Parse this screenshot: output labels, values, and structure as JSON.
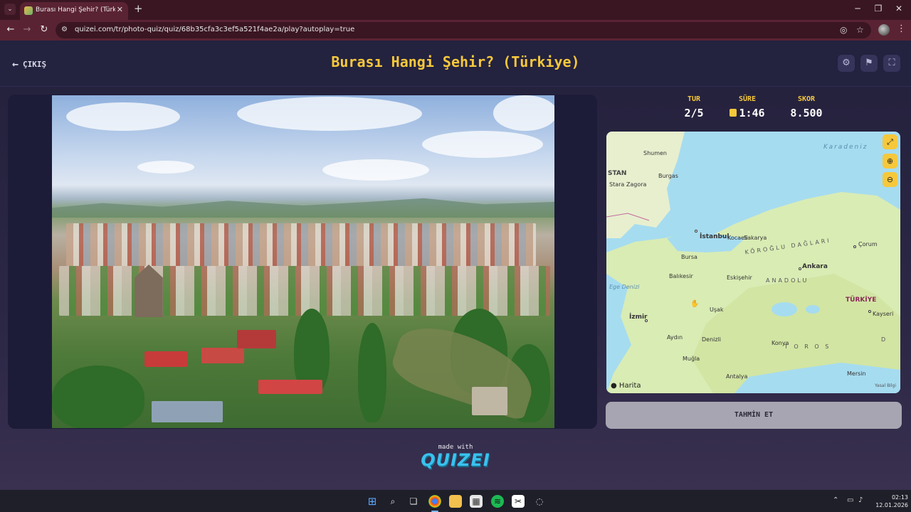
{
  "browser": {
    "tab_title": "Burası Hangi Şehir? (Türkiye) - Q",
    "url": "quizei.com/tr/photo-quiz/quiz/68b35cfa3c3ef5a521f4ae2a/play?autoplay=true"
  },
  "header": {
    "back_label": "ÇIKIŞ",
    "title": "Burası Hangi Şehir? (Türkiye)"
  },
  "stats": {
    "round_label": "TUR",
    "round_value": "2/5",
    "time_label": "SÜRE",
    "time_value": "1:46",
    "score_label": "SKOR",
    "score_value": "8.500"
  },
  "map": {
    "brand": "Harita",
    "legal": "Yasal Bilgi",
    "country_label": "TÜRKİYE",
    "cities": [
      "Shumen",
      "Burgas",
      "Stara Zagora",
      "İstanbul",
      "Kocaeli",
      "Sakarya",
      "Bursa",
      "Balıkesir",
      "Eskişehir",
      "Ankara",
      "Çorum",
      "Kayseri",
      "İzmir",
      "Uşak",
      "Aydın",
      "Denizli",
      "Muğla",
      "Konya",
      "Antalya",
      "Mersin"
    ],
    "regions": [
      "KÖROĞLU DAĞLARI",
      "ANADOLU",
      "T O R O S",
      "D",
      "STAN"
    ],
    "seas": [
      "Karadeniz",
      "Ege Denizi"
    ]
  },
  "guess_button": "TAHMİN ET",
  "footer": {
    "made_with": "made with",
    "brand": "QUIZEI"
  },
  "taskbar": {
    "time": "02:13",
    "date": "12.01.2026"
  }
}
